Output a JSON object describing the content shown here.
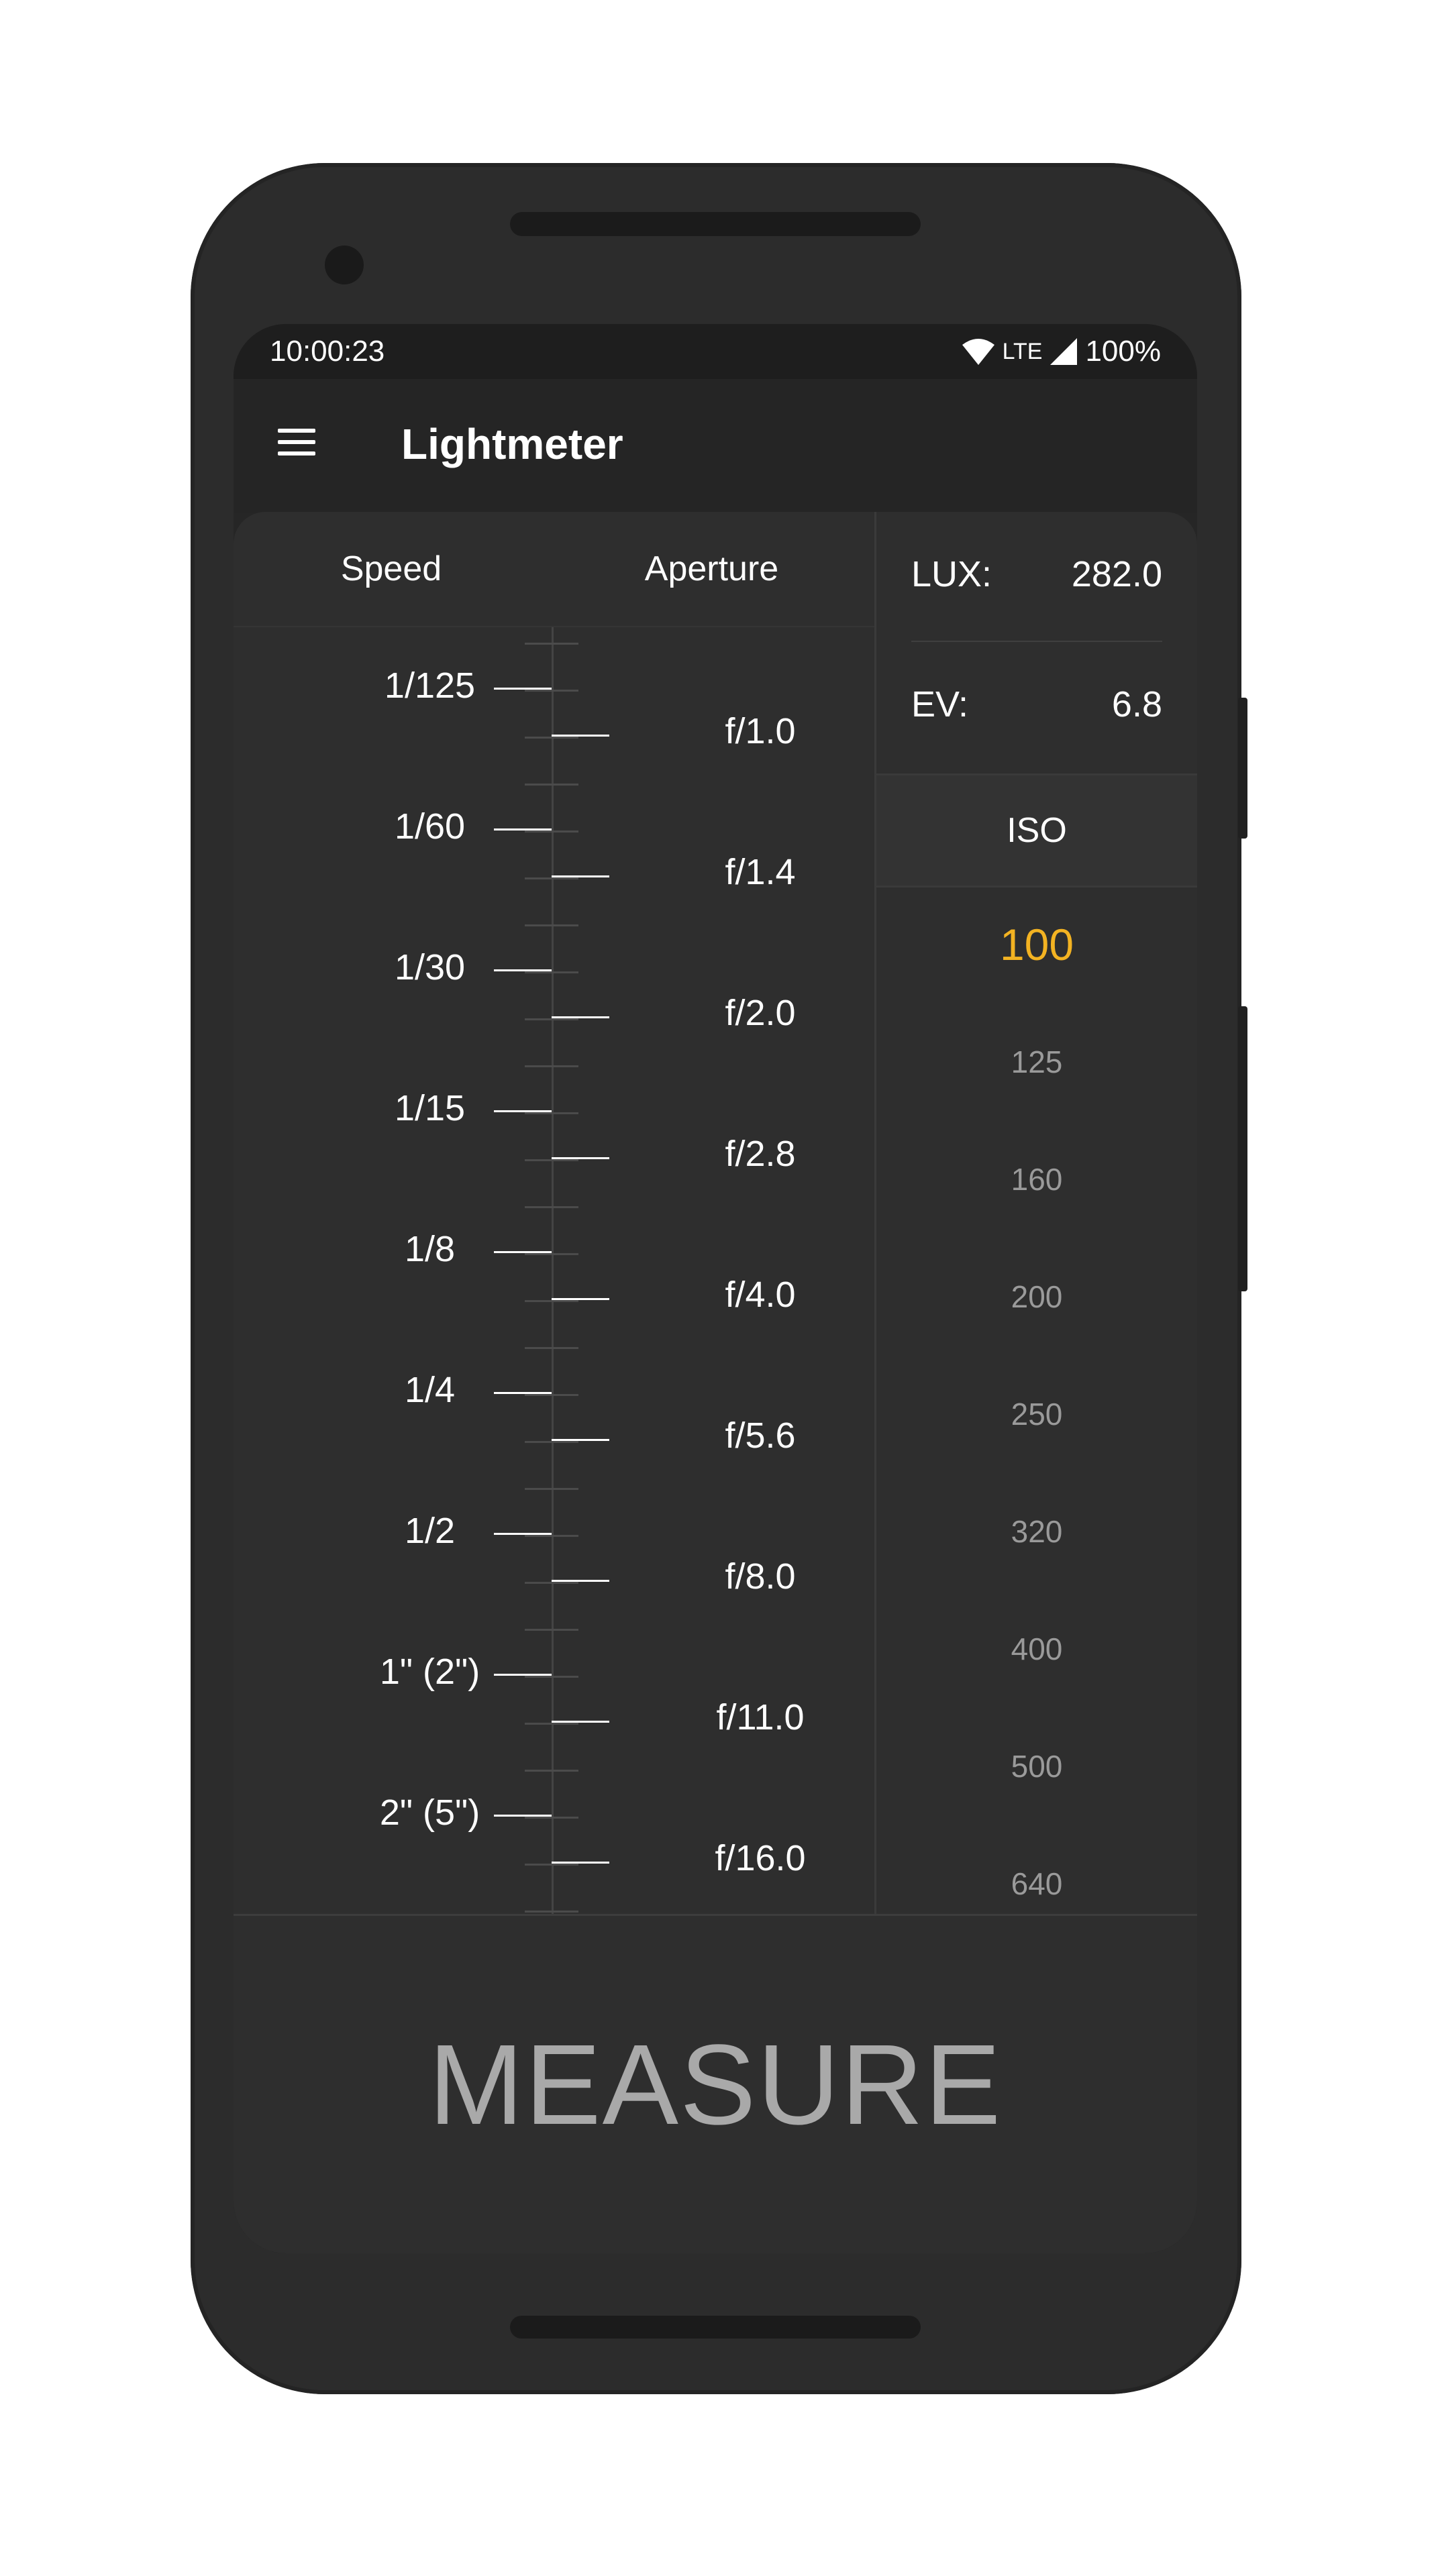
{
  "status_bar": {
    "time": "10:00:23",
    "network": "LTE",
    "battery": "100%"
  },
  "app_bar": {
    "title": "Lightmeter",
    "menu_icon": "hamburger-menu-icon"
  },
  "columns": {
    "speed_header": "Speed",
    "aperture_header": "Aperture"
  },
  "speeds": [
    "1/125",
    "1/60",
    "1/30",
    "1/15",
    "1/8",
    "1/4",
    "1/2",
    "1\" (2\")",
    "2\" (5\")"
  ],
  "apertures": [
    "f/1.0",
    "f/1.4",
    "f/2.0",
    "f/2.8",
    "f/4.0",
    "f/5.6",
    "f/8.0",
    "f/11.0",
    "f/16.0"
  ],
  "readings": {
    "lux_label": "LUX:",
    "lux_value": "282.0",
    "ev_label": "EV:",
    "ev_value": "6.8"
  },
  "iso": {
    "header": "ISO",
    "selected": "100",
    "values": [
      "100",
      "125",
      "160",
      "200",
      "250",
      "320",
      "400",
      "500",
      "640"
    ]
  },
  "measure_button": {
    "label": "MEASURE"
  },
  "colors": {
    "accent": "#f3b322",
    "background": "#2e2e2e",
    "text": "#ffffff"
  }
}
